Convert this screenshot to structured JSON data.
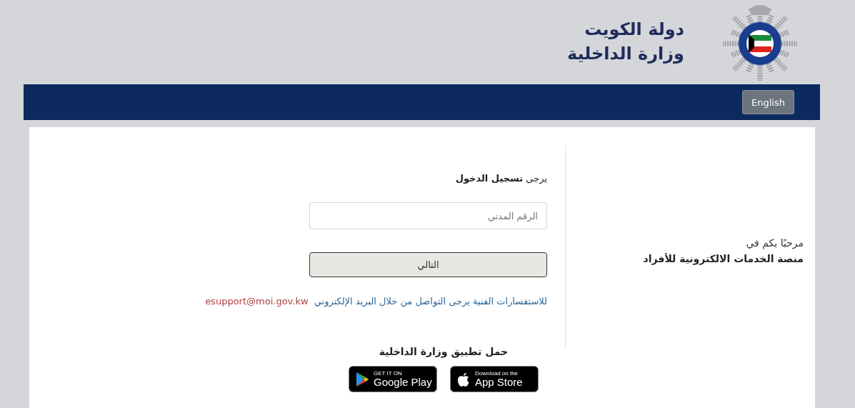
{
  "header": {
    "title_line_1": "دولة الكويت",
    "title_line_2": "وزارة الداخلية"
  },
  "nav": {
    "language_button": "English"
  },
  "welcome": {
    "line_1": "مرحبًا بكم في",
    "line_2": "منصة الخدمات الالكترونية للأفراد"
  },
  "login": {
    "heading": "يرجى **تسجيل الدخول**",
    "civil_id": {
      "placeholder": "الرقم المدني"
    },
    "next_button": "التالي",
    "support_text": "للاستفسارات الفنية يرجى التواصل من خلال البريد الإلكتروني",
    "support_email": "esupport@moi.gov.kw"
  },
  "download": {
    "heading": "حمل تطبيق وزارة الداخلية",
    "badges": [
      {
        "kind": "apple",
        "small": "Download on the",
        "large": "App Store"
      },
      {
        "kind": "google",
        "small": "GET IT ON",
        "large": "Google Play"
      }
    ]
  }
}
